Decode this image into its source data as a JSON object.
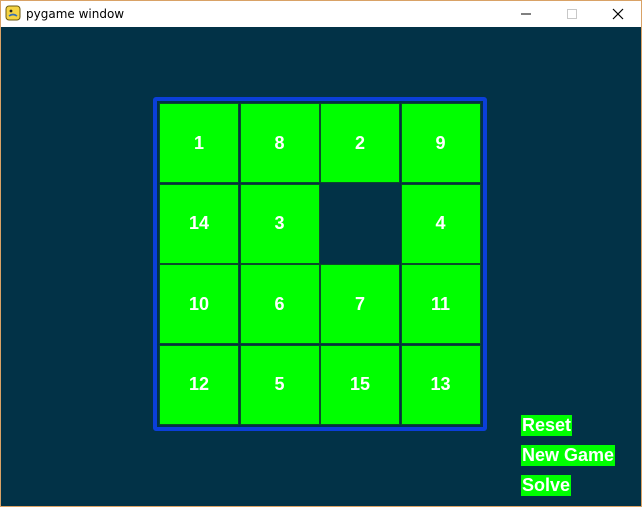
{
  "window": {
    "title": "pygame window"
  },
  "board": {
    "rows": [
      [
        1,
        8,
        2,
        9
      ],
      [
        14,
        3,
        null,
        4
      ],
      [
        10,
        6,
        7,
        11
      ],
      [
        12,
        5,
        15,
        13
      ]
    ]
  },
  "menu": {
    "reset_label": "Reset",
    "new_game_label": "New Game",
    "solve_label": "Solve"
  },
  "colors": {
    "background": "#023247",
    "tile": "#00ff00",
    "frame": "#0b3fd9",
    "text": "#ffffff"
  }
}
